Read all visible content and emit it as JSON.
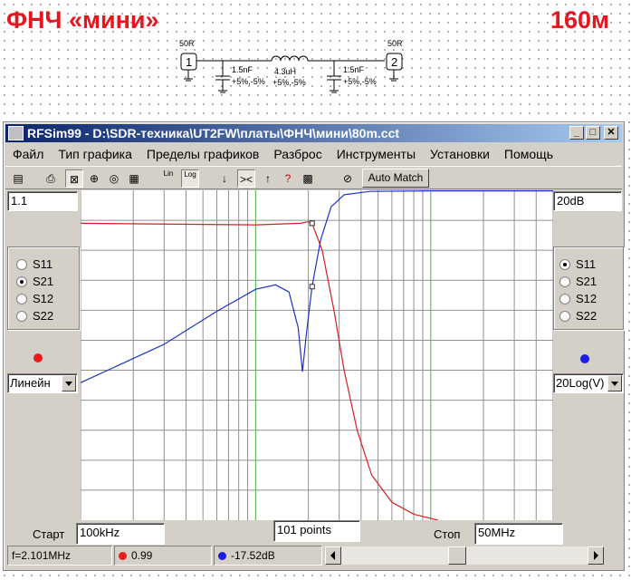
{
  "heading": {
    "left": "ФНЧ «мини»",
    "right": "160м"
  },
  "schematic": {
    "port1": {
      "number": "1",
      "impedance": "50R"
    },
    "port2": {
      "number": "2",
      "impedance": "50R"
    },
    "cap1": {
      "value": "1.5nF",
      "tolerance": "+5%,-5%"
    },
    "inductor": {
      "value": "4.3uH",
      "tolerance": "+5%,-5%"
    },
    "cap2": {
      "value": "1.5nF",
      "tolerance": "+5%,-5%"
    }
  },
  "window": {
    "title": "RFSim99 - D:\\SDR-техника\\UT2FW\\платы\\ФНЧ\\мини\\80m.cct",
    "controls": {
      "minimize": "_",
      "maximize": "□",
      "close": "✕"
    }
  },
  "menu": [
    "Файл",
    "Тип графика",
    "Пределы графиков",
    "Разброс",
    "Инструменты",
    "Установки",
    "Помощь"
  ],
  "toolbar": {
    "lin_label": "Lin",
    "log_label": "Log",
    "auto_match_label": "Auto Match"
  },
  "left_panel": {
    "scale_value": "1.1",
    "params": [
      "S11",
      "S21",
      "S12",
      "S22"
    ],
    "selected": "S21",
    "marker_color": "#e81c1c",
    "scale_mode": "Линейн"
  },
  "right_panel": {
    "scale_value": "20dB",
    "params": [
      "S11",
      "S21",
      "S12",
      "S22"
    ],
    "selected": "S11",
    "marker_color": "#1c1ce8",
    "scale_mode": "20Log(V)"
  },
  "sweep": {
    "start_label": "Старт",
    "start_value": "100kHz",
    "points": "101 points",
    "stop_label": "Стоп",
    "stop_value": "50MHz"
  },
  "status": {
    "frequency": "f=2.101MHz",
    "red_value": "0.99",
    "blue_value": "-17.52dB"
  },
  "chart_data": {
    "type": "line",
    "x_range": [
      0.1,
      50
    ],
    "x_unit": "MHz",
    "series": [
      {
        "color": "#d42020",
        "axis": "left-linear",
        "points": [
          [
            0.1,
            0.99
          ],
          [
            1.0,
            0.985
          ],
          [
            1.8,
            0.99
          ],
          [
            2.0,
            0.995
          ],
          [
            2.1,
            0.99
          ],
          [
            2.4,
            0.9
          ],
          [
            2.8,
            0.7
          ],
          [
            3.2,
            0.5
          ],
          [
            3.8,
            0.3
          ],
          [
            4.6,
            0.15
          ],
          [
            6,
            0.06
          ],
          [
            8,
            0.02
          ],
          [
            11,
            0.0
          ]
        ]
      },
      {
        "color": "#1e32c8",
        "axis": "right-dB",
        "points": [
          [
            0.1,
            -35
          ],
          [
            0.3,
            -28
          ],
          [
            0.6,
            -22
          ],
          [
            1.0,
            -18
          ],
          [
            1.3,
            -17.2
          ],
          [
            1.55,
            -18.5
          ],
          [
            1.75,
            -25
          ],
          [
            1.85,
            -33
          ],
          [
            1.95,
            -26
          ],
          [
            2.1,
            -17.5
          ],
          [
            2.35,
            -9
          ],
          [
            2.7,
            -3
          ],
          [
            3.2,
            -0.8
          ],
          [
            4.5,
            -0.2
          ],
          [
            10,
            -0.1
          ],
          [
            50,
            -0.1
          ]
        ]
      }
    ],
    "markers": [
      [
        2.1,
        0.99
      ],
      [
        2.1,
        -17.52
      ]
    ]
  }
}
